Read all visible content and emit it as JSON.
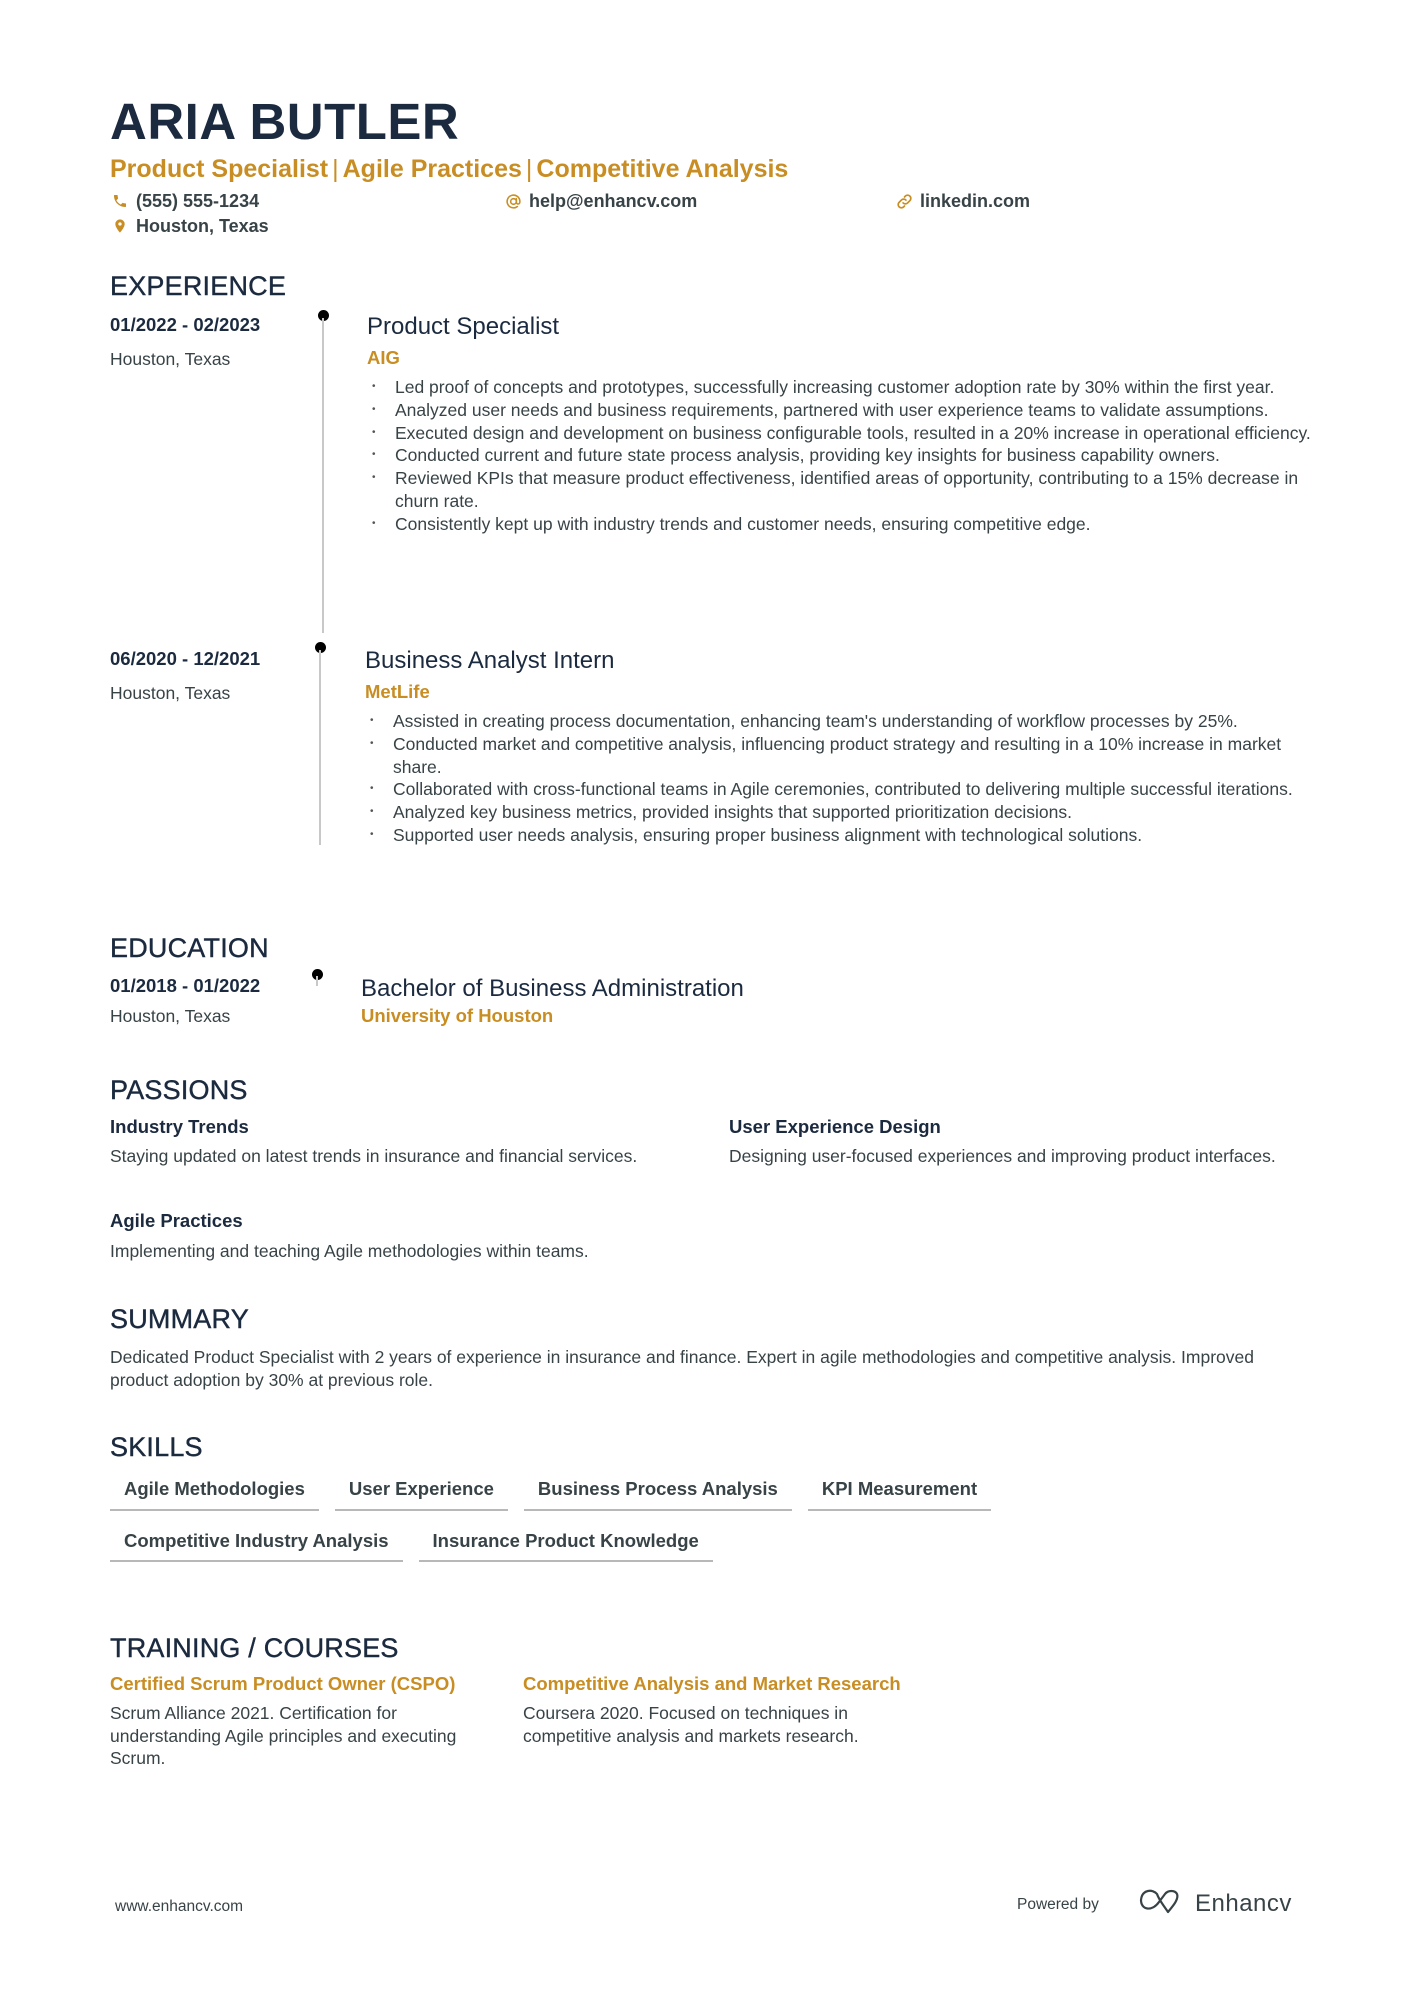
{
  "header": {
    "name": "ARIA BUTLER",
    "subtitle_parts": [
      "Product Specialist",
      "Agile Practices",
      "Competitive Analysis"
    ],
    "subtitle_separator": "|",
    "contacts": {
      "phone": {
        "icon": "phone-icon",
        "text": "(555) 555-1234"
      },
      "email": {
        "icon": "at-icon",
        "text": "help@enhancv.com"
      },
      "linkedin": {
        "icon": "link-icon",
        "text": "linkedin.com"
      },
      "location": {
        "icon": "location-pin-icon",
        "text": "Houston, Texas"
      }
    }
  },
  "colors": {
    "accent": "#c88d23",
    "heading": "#1b2a3f",
    "body": "#384347",
    "timeline": "#c8c8c8"
  },
  "experience": {
    "title": "EXPERIENCE",
    "items": [
      {
        "dates": "01/2022 - 02/2023",
        "location": "Houston, Texas",
        "role": "Product Specialist",
        "company": "AIG",
        "bullets": [
          "Led proof of concepts and prototypes, successfully increasing customer adoption rate by 30% within the first year.",
          "Analyzed user needs and business requirements, partnered with user experience teams to validate assumptions.",
          "Executed design and development on business configurable tools, resulted in a 20% increase in operational efficiency.",
          "Conducted current and future state process analysis, providing key insights for business capability owners.",
          "Reviewed KPIs that measure product effectiveness, identified areas of opportunity, contributing to a 15% decrease in churn rate.",
          "Consistently kept up with industry trends and customer needs, ensuring competitive edge."
        ]
      },
      {
        "dates": "06/2020 - 12/2021",
        "location": "Houston, Texas",
        "role": "Business Analyst Intern",
        "company": "MetLife",
        "bullets": [
          "Assisted in creating process documentation, enhancing team's understanding of workflow processes by 25%.",
          "Conducted market and competitive analysis, influencing product strategy and resulting in a 10% increase in market share.",
          "Collaborated with cross-functional teams in Agile ceremonies, contributed to delivering multiple successful iterations.",
          "Analyzed key business metrics, provided insights that supported prioritization decisions.",
          "Supported user needs analysis, ensuring proper business alignment with technological solutions."
        ]
      }
    ]
  },
  "education": {
    "title": "EDUCATION",
    "items": [
      {
        "dates": "01/2018 - 01/2022",
        "location": "Houston, Texas",
        "degree": "Bachelor of Business Administration",
        "school": "University of Houston"
      }
    ]
  },
  "passions": {
    "title": "PASSIONS",
    "items": [
      {
        "title": "Industry Trends",
        "desc": "Staying updated on latest trends in insurance and financial services."
      },
      {
        "title": "User Experience Design",
        "desc": "Designing user-focused experiences and improving product interfaces."
      },
      {
        "title": "Agile Practices",
        "desc": "Implementing and teaching Agile methodologies within teams."
      }
    ]
  },
  "summary": {
    "title": "SUMMARY",
    "text": "Dedicated Product Specialist with 2 years of experience in insurance and finance. Expert in agile methodologies and competitive analysis. Improved product adoption by 30% at previous role."
  },
  "skills": {
    "title": "SKILLS",
    "items": [
      "Agile Methodologies",
      "User Experience",
      "Business Process Analysis",
      "KPI Measurement",
      "Competitive Industry Analysis",
      "Insurance Product Knowledge"
    ]
  },
  "training": {
    "title": "TRAINING / COURSES",
    "items": [
      {
        "title": "Certified Scrum Product Owner (CSPO)",
        "desc": "Scrum Alliance 2021. Certification for understanding Agile principles and executing Scrum."
      },
      {
        "title": "Competitive Analysis and Market Research",
        "desc": "Coursera 2020. Focused on techniques in competitive analysis and markets research."
      }
    ]
  },
  "footer": {
    "website": "www.enhancv.com",
    "powered_by": "Powered by",
    "brand": "Enhancv"
  }
}
